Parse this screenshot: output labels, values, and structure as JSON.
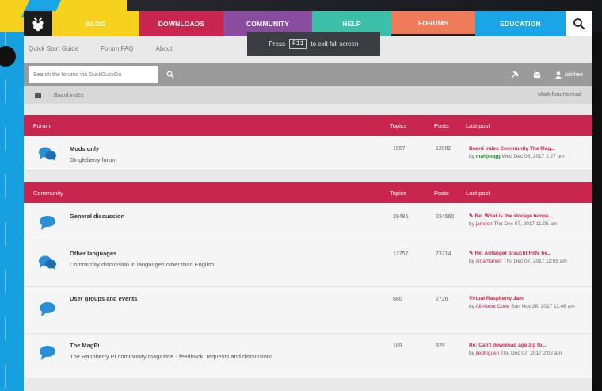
{
  "nav": {
    "items": [
      {
        "label": "Blog",
        "color": "#f6d21e"
      },
      {
        "label": "Downloads",
        "color": "#c8254f"
      },
      {
        "label": "Community",
        "color": "#8a4c9e"
      },
      {
        "label": "Help",
        "color": "#3bbfa8"
      },
      {
        "label": "Forums",
        "color": "#f07b5a"
      },
      {
        "label": "Education",
        "color": "#1aa5e6"
      }
    ]
  },
  "subnav": {
    "quick_start": "Quick Start Guide",
    "faq": "Forum FAQ",
    "about": "About"
  },
  "fullscreen_toast": {
    "press": "Press",
    "key": "F11",
    "rest": "to exit full screen"
  },
  "search": {
    "placeholder": "Search the forums via DuckDuckGo"
  },
  "user": {
    "name": "raldhez"
  },
  "breadcrumb": {
    "board_index": "Board index",
    "mark_read": "Mark forums read"
  },
  "forum_section": {
    "header": "Forum",
    "topics_label": "Topics",
    "posts_label": "Posts",
    "last_post_label": "Last post",
    "rows": [
      {
        "title": "Mods only",
        "desc": "Dingleberry forum",
        "topics": "1557",
        "posts": "13982",
        "last_title": "Board index Community The Mag...",
        "last_by": "by",
        "last_user": "mahjongg",
        "last_date": "Wed Dec 06, 2017 2:27 pm"
      }
    ]
  },
  "community_section": {
    "header": "Community",
    "topics_label": "Topics",
    "posts_label": "Posts",
    "last_post_label": "Last post",
    "rows": [
      {
        "title": "General discussion",
        "desc": "",
        "topics": "28485",
        "posts": "234560",
        "last_title": "Re: What is the storage tempe...",
        "last_by": "by",
        "last_user": "jamesh",
        "last_date": "Thu Dec 07, 2017 11:05 am"
      },
      {
        "title": "Other languages",
        "desc": "Community discussion in languages other than English",
        "topics": "13757",
        "posts": "73714",
        "last_title": "Re: Anfänger braucht Hilfe be...",
        "last_by": "by",
        "last_user": "smartfahrer",
        "last_date": "Thu Dec 07, 2017 11:05 am"
      },
      {
        "title": "User groups and events",
        "desc": "",
        "topics": "680",
        "posts": "2726",
        "last_title": "Virtual Raspberry Jam",
        "last_by": "by",
        "last_user": "All About Code",
        "last_date": "Sun Nov 26, 2017 11:46 am"
      },
      {
        "title": "The MagPi",
        "desc": "The Raspberry Pi community magazine - feedback, requests and discussion!",
        "topics": "189",
        "posts": "829",
        "last_title": "Re: Can't download age.zip fo...",
        "last_by": "by",
        "last_user": "jlephiguen",
        "last_date": "Thu Dec 07, 2017 2:02 am"
      }
    ]
  },
  "colors": {
    "accent_red": "#c8254f",
    "bubble_blue": "#2a8fd6",
    "search_bar_grey": "#9b9b9b"
  }
}
